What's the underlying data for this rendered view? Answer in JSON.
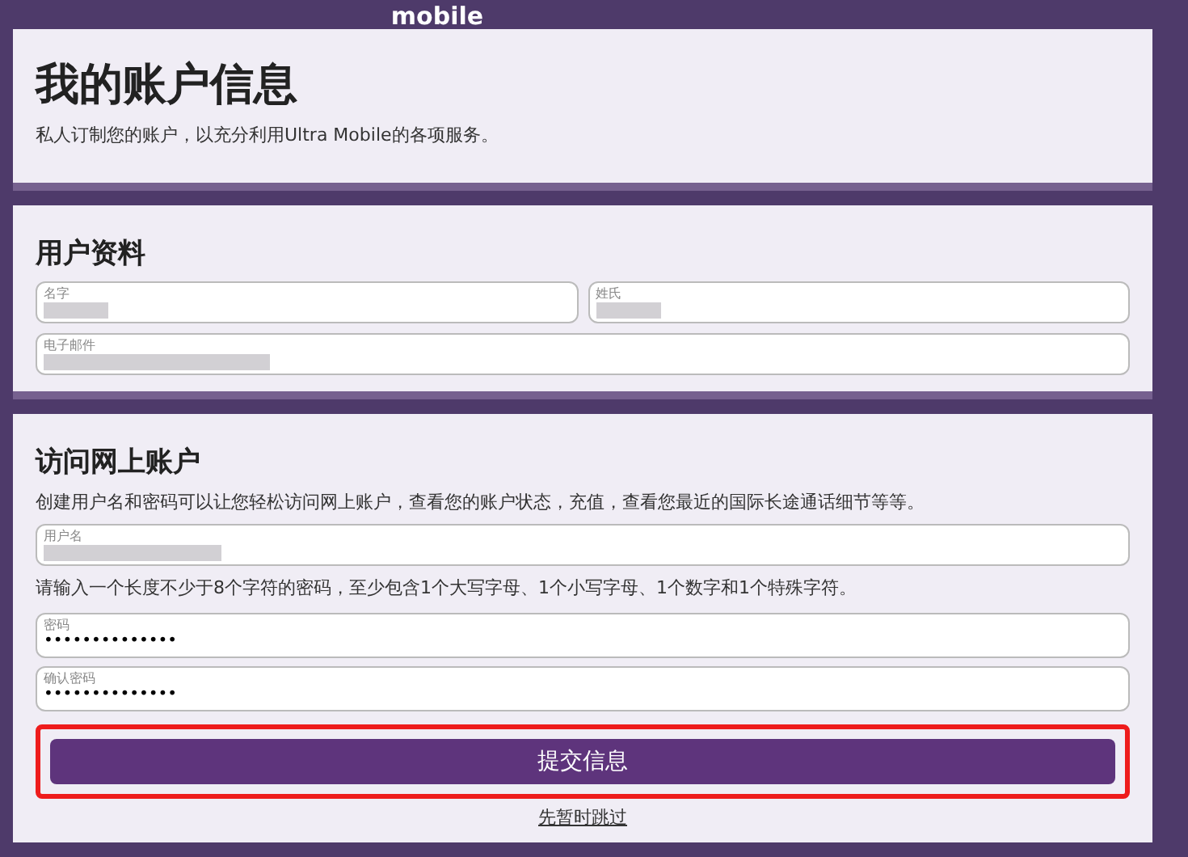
{
  "header": {
    "logo": "mobile"
  },
  "intro": {
    "title": "我的账户信息",
    "subtitle": "私人订制您的账户，以充分利用Ultra Mobile的各项服务。"
  },
  "profile": {
    "title": "用户资料",
    "fields": [
      {
        "label": "名字",
        "redacted": true
      },
      {
        "label": "姓氏",
        "redacted": true
      },
      {
        "label": "电子邮件",
        "redacted": true
      }
    ]
  },
  "online_account": {
    "title": "访问网上账户",
    "description": "创建用户名和密码可以让您轻松访问网上账户，查看您的账户状态，充值，查看您最近的国际长途通话细节等等。",
    "username": {
      "label": "用户名",
      "redacted": true
    },
    "password_hint": "请输入一个长度不少于8个字符的密码，至少包含1个大写字母、1个小写字母、1个数字和1个特殊字符。",
    "passwords": [
      {
        "label": "密码",
        "value": "••••••••••••••"
      },
      {
        "label": "确认密码",
        "value": "••••••••••••••"
      }
    ],
    "submit": "提交信息",
    "skip": "先暂时跳过",
    "highlighted": true
  }
}
